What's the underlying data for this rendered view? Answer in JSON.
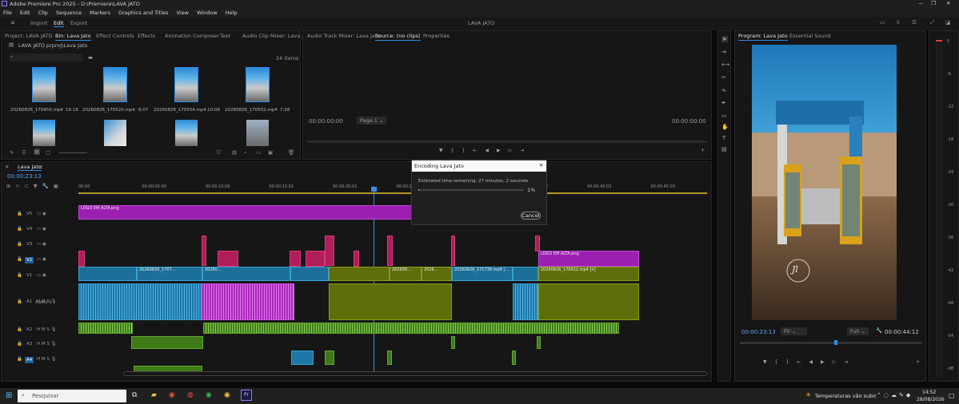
{
  "titlebar": {
    "app_title": "Adobe Premiere Pro 2025 - D:\\Premiere\\LAVA JATO"
  },
  "menu": [
    "File",
    "Edit",
    "Clip",
    "Sequence",
    "Markers",
    "Graphics and Titles",
    "View",
    "Window",
    "Help"
  ],
  "workspace": {
    "tabs": [
      "Import",
      "Edit",
      "Export"
    ],
    "active": "Edit",
    "project_name": "LAVA JATO"
  },
  "project_panel": {
    "tabs": [
      "Project: LAVA JATO",
      "Bin: Lava Jato",
      "Effect Controls",
      "Effects",
      "Animation Composer",
      "Text",
      "Audio Clip Mixer: Lava Jato"
    ],
    "path": "LAVA JATO.prproj\\Lava Jato",
    "item_count": "24 items",
    "items": [
      {
        "name": "20260826_170450.mp4",
        "duration": "16:18"
      },
      {
        "name": "20260826_170520.mp4",
        "duration": "6:07"
      },
      {
        "name": "20260826_170554.mp4",
        "duration": "10:08"
      },
      {
        "name": "20260826_170552.mp4",
        "duration": "7:28"
      }
    ]
  },
  "source_panel": {
    "tabs": [
      "Audio Track Mixer: Lava Jato",
      "Source: (no clips)",
      "Properties"
    ],
    "timecode_left": "00:00:00:00",
    "timecode_right": "00:00:00:00",
    "page": "Page 1"
  },
  "program_panel": {
    "tabs": [
      "Program: Lava Jato",
      "Essential Sound"
    ],
    "timecode_left": "00:00:23:13",
    "fit": "Fit",
    "quality": "Full",
    "timecode_right": "00:00:44:12",
    "watermark_text": "Jl"
  },
  "timeline": {
    "sequence_name": "Lava Jato",
    "timecode": "00:00:23:13",
    "ruler": [
      "00:00",
      "00:00:05:00",
      "00:00:10:00",
      "00:00:15:01",
      "00:00:20:01",
      "00:00:25:01",
      "00:00:30:01",
      "00:00:35:02",
      "00:00:40:02",
      "00:00:45:03"
    ],
    "tracks_video": [
      "V5",
      "V4",
      "V3",
      "V2",
      "V1"
    ],
    "tracks_audio": [
      "A1",
      "A2",
      "A3",
      "A4"
    ],
    "audio1_name": "Audio 1",
    "clips": {
      "v5_logo": "LOGO EM ALTA.png",
      "v2_logo": "LOGO EM ALTA.png",
      "v1_a": "20260826_1707...",
      "v1_b": "20260...",
      "v1_c": "202608...",
      "v1_d": "2026...",
      "v1_e": "20260826_171736.mp4 [...",
      "v1_f": "20260826_170622.mp4 [V]"
    }
  },
  "dialog": {
    "title": "Encoding Lava Jato",
    "estimate": "Estimated time remaining: 27 minutes, 2 seconds",
    "progress": 1,
    "progress_label": "1%",
    "cancel": "Cancel"
  },
  "meter_scale": [
    "0",
    "-6",
    "-12",
    "-18",
    "-24",
    "-30",
    "-36",
    "-42",
    "-48",
    "-54",
    "-dB"
  ],
  "taskbar": {
    "search_placeholder": "Pesquisar",
    "weather": "Temperaturas vão subir",
    "time": "14:52",
    "date": "28/08/2026"
  },
  "colors": {
    "accent": "#2d8ceb",
    "timeline_pink": "#b01e5a",
    "timeline_purple": "#9b1fb0",
    "timeline_blue": "#1c6f99",
    "timeline_olive": "#5f6e0a",
    "timeline_green": "#3f7a19"
  }
}
